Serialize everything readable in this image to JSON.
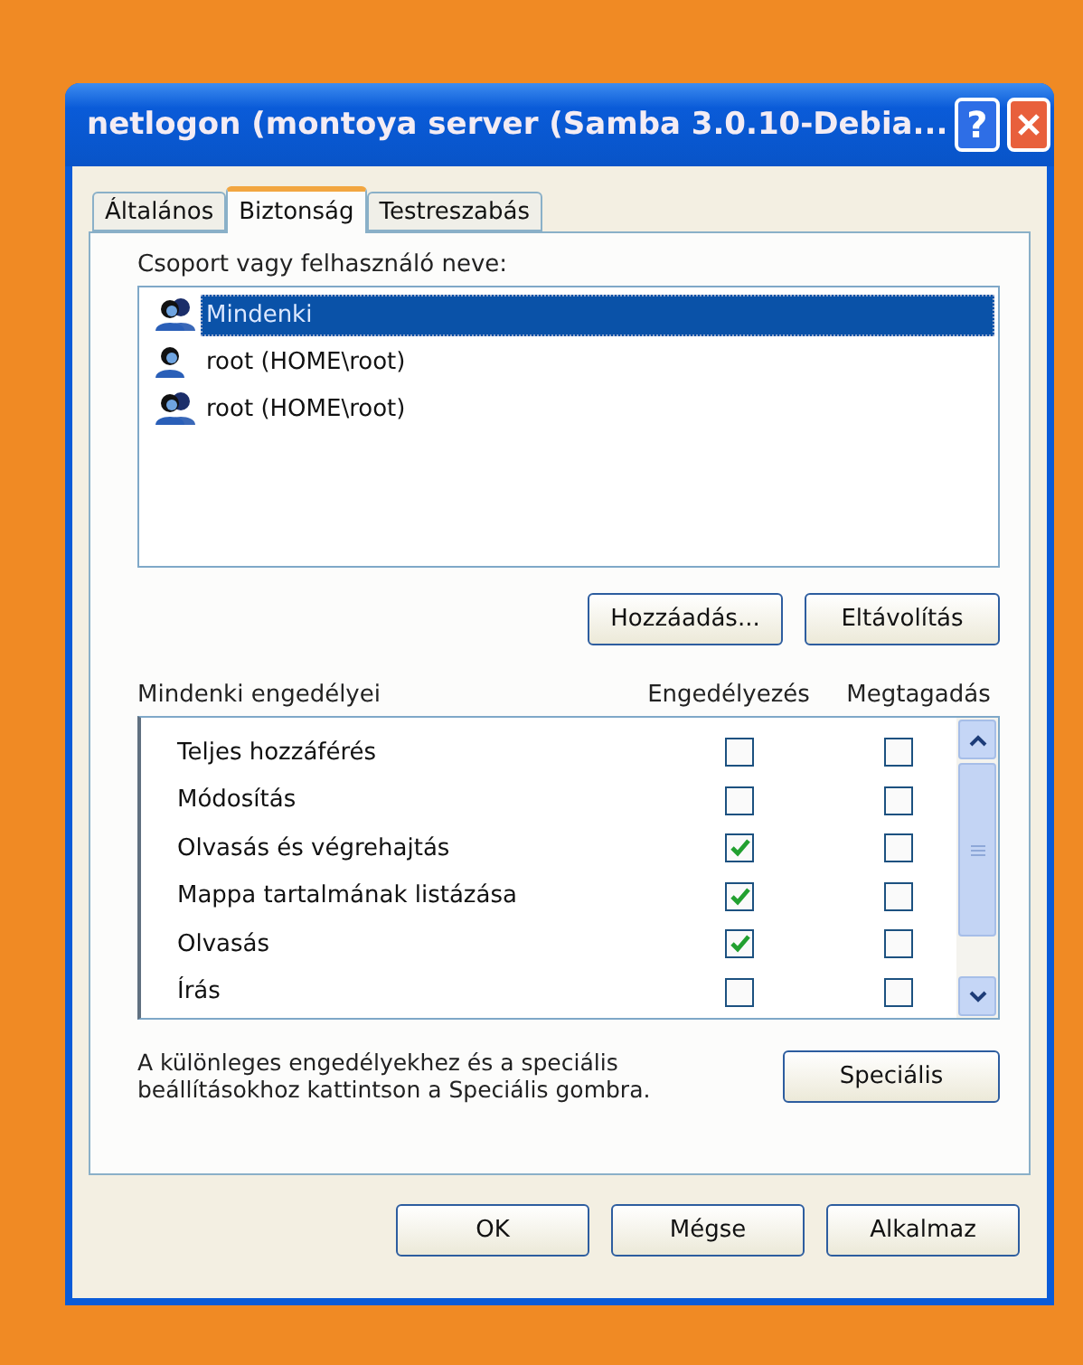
{
  "window": {
    "title": "netlogon (montoya server (Samba 3.0.10-Debia...",
    "buttons": [
      {
        "kind": "help",
        "label": "?"
      },
      {
        "kind": "close"
      }
    ]
  },
  "tabs": [
    {
      "label": "Általános",
      "selected": false
    },
    {
      "label": "Biztonság",
      "selected": true
    },
    {
      "label": "Testreszabás",
      "selected": false
    }
  ],
  "principals": {
    "label": "Csoport vagy felhasználó neve:",
    "items": [
      {
        "name": "Mindenki",
        "kind": "group",
        "selected": true
      },
      {
        "name": "root (HOME\\root)",
        "kind": "user",
        "selected": false
      },
      {
        "name": "root (HOME\\root)",
        "kind": "group",
        "selected": false
      }
    ],
    "buttons": [
      "Hozzáadás...",
      "Eltávolítás"
    ]
  },
  "permissions": {
    "columns": [
      "Mindenki engedélyei",
      "Engedélyezés",
      "Megtagadás"
    ],
    "rows": [
      {
        "name": "Teljes hozzáférés",
        "allow": false,
        "deny": false
      },
      {
        "name": "Módosítás",
        "allow": false,
        "deny": false
      },
      {
        "name": "Olvasás és végrehajtás",
        "allow": true,
        "deny": false
      },
      {
        "name": "Mappa tartalmának listázása",
        "allow": true,
        "deny": false
      },
      {
        "name": "Olvasás",
        "allow": true,
        "deny": false
      },
      {
        "name": "Írás",
        "allow": false,
        "deny": false
      }
    ]
  },
  "special": {
    "note": "A különleges engedélyekhez és a speciális beállításokhoz kattintson a Speciális gombra.",
    "button": "Speciális"
  },
  "buttons": [
    "OK",
    "Mégse",
    "Alkalmaz"
  ]
}
